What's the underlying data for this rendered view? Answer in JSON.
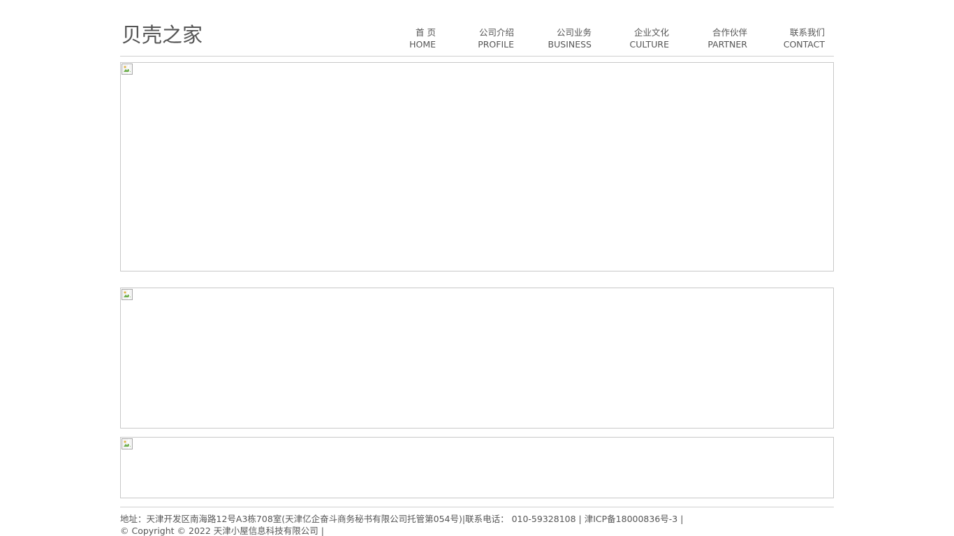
{
  "site": {
    "logo_text": "贝壳之家"
  },
  "nav": {
    "items": [
      {
        "cn": "首 页",
        "en": "HOME"
      },
      {
        "cn": "公司介绍",
        "en": "PROFILE"
      },
      {
        "cn": "公司业务",
        "en": "BUSINESS"
      },
      {
        "cn": "企业文化",
        "en": "CULTURE"
      },
      {
        "cn": "合作伙伴",
        "en": "PARTNER"
      },
      {
        "cn": "联系我们",
        "en": "CONTACT"
      }
    ]
  },
  "banners": [
    {
      "icon": "broken-image-icon"
    },
    {
      "icon": "broken-image-icon"
    },
    {
      "icon": "broken-image-icon"
    }
  ],
  "footer": {
    "address_line": "地址：天津开发区南海路12号A3栋708室(天津亿企奋斗商务秘书有限公司托管第054号)|联系电话： 010-59328108 | 津ICP备18000836号-3 |",
    "copyright_line": "© Copyright © 2022 天津小屋信息科技有限公司 |"
  },
  "colors": {
    "text": "#555555",
    "border": "#c8c8c8",
    "background": "#ffffff"
  }
}
